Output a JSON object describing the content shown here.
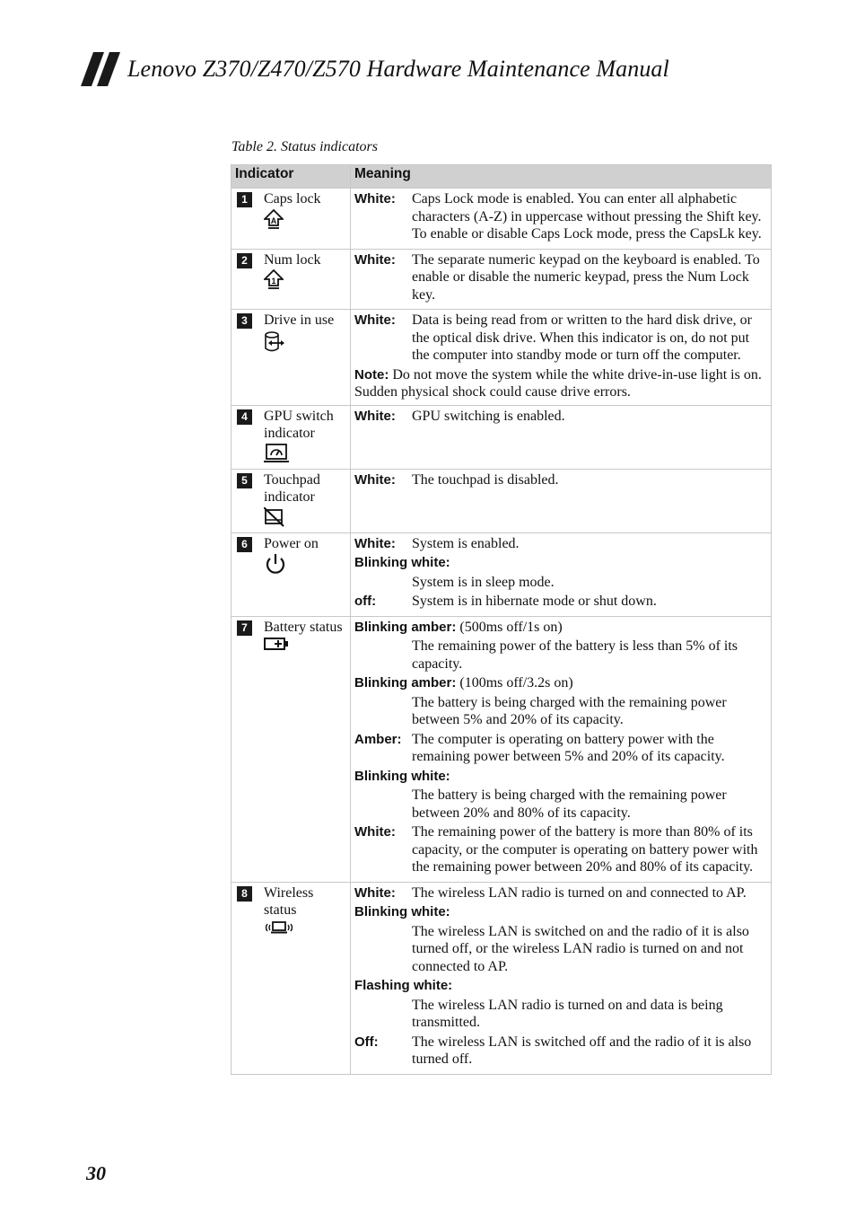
{
  "header": {
    "title": "Lenovo Z370/Z470/Z570 Hardware Maintenance Manual"
  },
  "table": {
    "caption": "Table 2. Status indicators",
    "columns": [
      "Indicator",
      "Meaning"
    ],
    "rows": [
      {
        "number": "1",
        "indicator": "Caps lock",
        "icon": "caps-lock-icon",
        "entries": [
          {
            "label": "White:",
            "text": "Caps Lock mode is enabled. You can enter all alphabetic characters (A-Z) in uppercase without pressing the Shift key. To enable or disable Caps Lock mode, press the CapsLk key."
          }
        ]
      },
      {
        "number": "2",
        "indicator": "Num lock",
        "icon": "num-lock-icon",
        "entries": [
          {
            "label": "White:",
            "text": "The separate numeric keypad on the keyboard is enabled. To enable or disable the numeric keypad, press the Num Lock key."
          }
        ]
      },
      {
        "number": "3",
        "indicator": "Drive in use",
        "icon": "drive-in-use-icon",
        "entries": [
          {
            "label": "White:",
            "text": "Data is being read from or written to the hard disk drive, or the optical disk drive. When this indicator is on, do not put the computer into standby mode or turn off the computer."
          }
        ],
        "note": {
          "label": "Note:",
          "text": "Do not move the system while the white drive-in-use light is on. Sudden physical shock could cause drive errors."
        }
      },
      {
        "number": "4",
        "indicator": "GPU switch indicator",
        "icon": "gpu-switch-icon",
        "entries": [
          {
            "label": "White:",
            "text": "GPU switching is enabled."
          }
        ]
      },
      {
        "number": "5",
        "indicator": "Touchpad indicator",
        "icon": "touchpad-disabled-icon",
        "entries": [
          {
            "label": "White:",
            "text": "The touchpad is disabled."
          }
        ]
      },
      {
        "number": "6",
        "indicator": "Power on",
        "icon": "power-icon",
        "entries": [
          {
            "label": "White:",
            "text": "System is enabled."
          },
          {
            "label": "Blinking white:",
            "text": "System is in sleep mode.",
            "block": true
          },
          {
            "label": "off:",
            "text": "System is in hibernate mode or shut down."
          }
        ]
      },
      {
        "number": "7",
        "indicator": "Battery status",
        "icon": "battery-icon",
        "entries": [
          {
            "label": "Blinking amber:",
            "suffix": "(500ms off/1s on)",
            "text": "The remaining power of the battery is less than 5% of its capacity.",
            "block": true
          },
          {
            "label": "Blinking amber:",
            "suffix": "(100ms off/3.2s on)",
            "text": "The battery is being charged with the remaining power between 5% and 20% of its capacity.",
            "block": true
          },
          {
            "label": "Amber:",
            "text": "The computer is operating on battery power with the remaining power between 5% and 20% of its capacity."
          },
          {
            "label": "Blinking white:",
            "text": "The battery is being charged with the remaining power between 20% and 80% of its capacity.",
            "block": true
          },
          {
            "label": "White:",
            "text": "The remaining power of the battery is more than 80% of its capacity, or the computer is operating on battery power with the remaining power between 20% and 80% of its capacity."
          }
        ]
      },
      {
        "number": "8",
        "indicator": "Wireless status",
        "icon": "wireless-status-icon",
        "entries": [
          {
            "label": "White:",
            "text": "The wireless LAN radio is turned on and connected to AP."
          },
          {
            "label": "Blinking white:",
            "text": "The wireless LAN is switched on and the radio of it is also turned off, or the wireless LAN radio is turned on and not connected to AP.",
            "block": true
          },
          {
            "label": "Flashing white:",
            "text": "The wireless LAN radio is turned on and data is being transmitted.",
            "block": true
          },
          {
            "label": "Off:",
            "text": "The wireless LAN is switched off and the radio of it is also turned off."
          }
        ]
      }
    ]
  },
  "footer": {
    "page_number": "30"
  },
  "colors": {
    "header_row_bg": "#d0d0d0",
    "border": "#c8c8c8",
    "number_badge_bg": "#1a1a1a"
  }
}
